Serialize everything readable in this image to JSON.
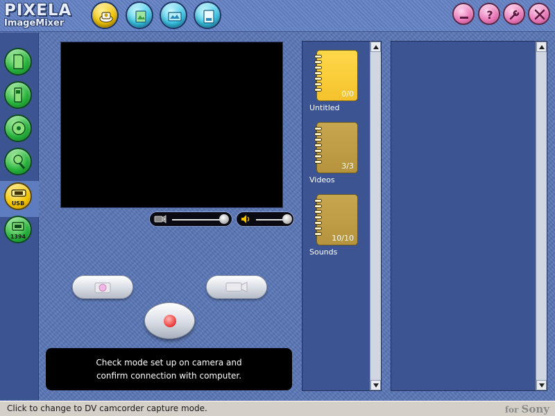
{
  "app": {
    "logo_line1": "PIXELA",
    "logo_line2": "ImageMixer"
  },
  "toolbar": {
    "modes": [
      {
        "icon": "capture-icon",
        "color": "#f2c400"
      },
      {
        "icon": "album-icon",
        "color": "#38c6e8"
      },
      {
        "icon": "edit-icon",
        "color": "#38c6e8"
      },
      {
        "icon": "output-icon",
        "color": "#38c6e8"
      }
    ],
    "system": [
      {
        "icon": "minimize-icon"
      },
      {
        "icon": "help-icon"
      },
      {
        "icon": "settings-icon"
      },
      {
        "icon": "close-icon"
      }
    ]
  },
  "sidebar": {
    "items": [
      {
        "icon": "memory-card-icon"
      },
      {
        "icon": "memory-stick-icon"
      },
      {
        "icon": "disc-icon"
      },
      {
        "icon": "scanner-icon"
      },
      {
        "icon": "usb-camera-icon",
        "label": "USB",
        "active": true
      },
      {
        "icon": "dv-camera-icon",
        "label": "1394"
      }
    ]
  },
  "preview": {
    "message_line1": "Check mode set up on camera and",
    "message_line2": "confirm connection with computer."
  },
  "albums": [
    {
      "name": "Untitled",
      "count": "0/0",
      "selected": true
    },
    {
      "name": "Videos",
      "count": "3/3",
      "selected": false
    },
    {
      "name": "Sounds",
      "count": "10/10",
      "selected": false
    }
  ],
  "status": {
    "message": "Click to change to DV camcorder capture mode.",
    "brand_prefix": "for",
    "brand_name": "Sony"
  },
  "colors": {
    "background": "#5875b5",
    "panel": "#3c5592",
    "accent_yellow": "#f2c400",
    "accent_cyan": "#38c6e8",
    "accent_green": "#27b23c",
    "accent_pink": "#e877b7"
  }
}
